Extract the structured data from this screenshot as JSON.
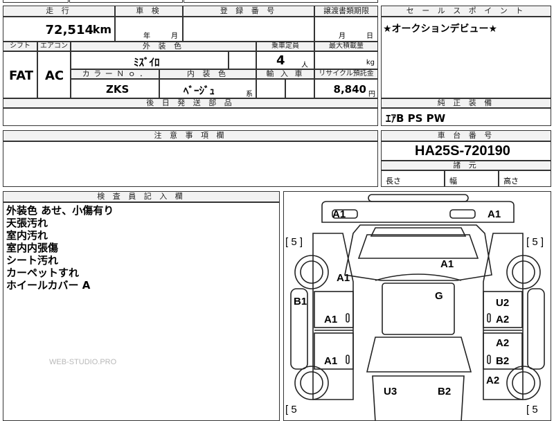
{
  "top_partial": {
    "a": "",
    "b": "",
    "c": ""
  },
  "mileage": {
    "header": "走 行",
    "value": "72,514",
    "unit": "km"
  },
  "inspection": {
    "header": "車 検",
    "year_label": "年",
    "month_label": "月",
    "value": ""
  },
  "registration": {
    "header": "登 録 番 号",
    "value": ""
  },
  "transfer_deadline": {
    "header": "譲渡書類期限",
    "month_label": "月",
    "day_label": "日"
  },
  "sales_point": {
    "header": "セ ー ル ス ポ イ ン ト",
    "text": "★オークションデビュー★"
  },
  "shift": {
    "header": "シフト",
    "value": "FAT"
  },
  "aircon": {
    "header": "エアコン",
    "value": "AC"
  },
  "exterior_color": {
    "header": "外 装 色",
    "value": "ﾐｽﾞｲﾛ"
  },
  "capacity": {
    "header": "乗車定員",
    "value": "4",
    "unit": "人"
  },
  "max_load": {
    "header": "最大積載量",
    "value": "",
    "unit": "kg"
  },
  "color_no": {
    "header": "カ ラ ー Ｎ ｏ ．",
    "value": "ZKS"
  },
  "interior_color": {
    "header": "内 装 色",
    "value": "ﾍﾞｰｼﾞｭ",
    "suffix": "系"
  },
  "import": {
    "header": "輸 入 車",
    "value": ""
  },
  "recycle": {
    "header": "リサイクル預託金",
    "value": "8,840",
    "unit": "円"
  },
  "later_parts": {
    "header": "後 日 発 送 部 品",
    "value": ""
  },
  "factory_equipment": {
    "header": "純 正 装 備",
    "value": "ｴｱB PS PW"
  },
  "caution": {
    "header": "注 意 事 項 欄",
    "value": ""
  },
  "chassis": {
    "header": "車 台 番 号",
    "value": "HA25S-720190"
  },
  "dimensions": {
    "header": "諸 元",
    "length": "長さ",
    "width": "幅",
    "height": "高さ"
  },
  "inspector": {
    "header": "検 査 員 記 入 欄",
    "lines": [
      "外装色 あせ、小傷有り",
      "天張汚れ",
      "室内汚れ",
      "室内内張傷",
      "シート汚れ",
      "カーペットすれ",
      "ホイールカバー A"
    ]
  },
  "watermark": "WEB-STUDIO.PRO",
  "diagram": {
    "labels": {
      "front_left": "A1",
      "front_right": "A1",
      "bracket_tl": "[ 5 ]",
      "bracket_tr": "[ 5 ]",
      "bracket_bl": "[ 5",
      "bracket_br": "[ 5",
      "hood": "A1",
      "left_fender": "A1",
      "left_front_bumper_side": "B1",
      "roof": "G",
      "left_front_door": "A1",
      "left_rear_door": "A1",
      "right_front_u2": "U2",
      "right_front_door": "A2",
      "right_rear_door": "A2",
      "right_rear_b2": "B2",
      "right_rear_quarter": "A2",
      "trunk_u3": "U3",
      "trunk_b2": "B2"
    }
  }
}
